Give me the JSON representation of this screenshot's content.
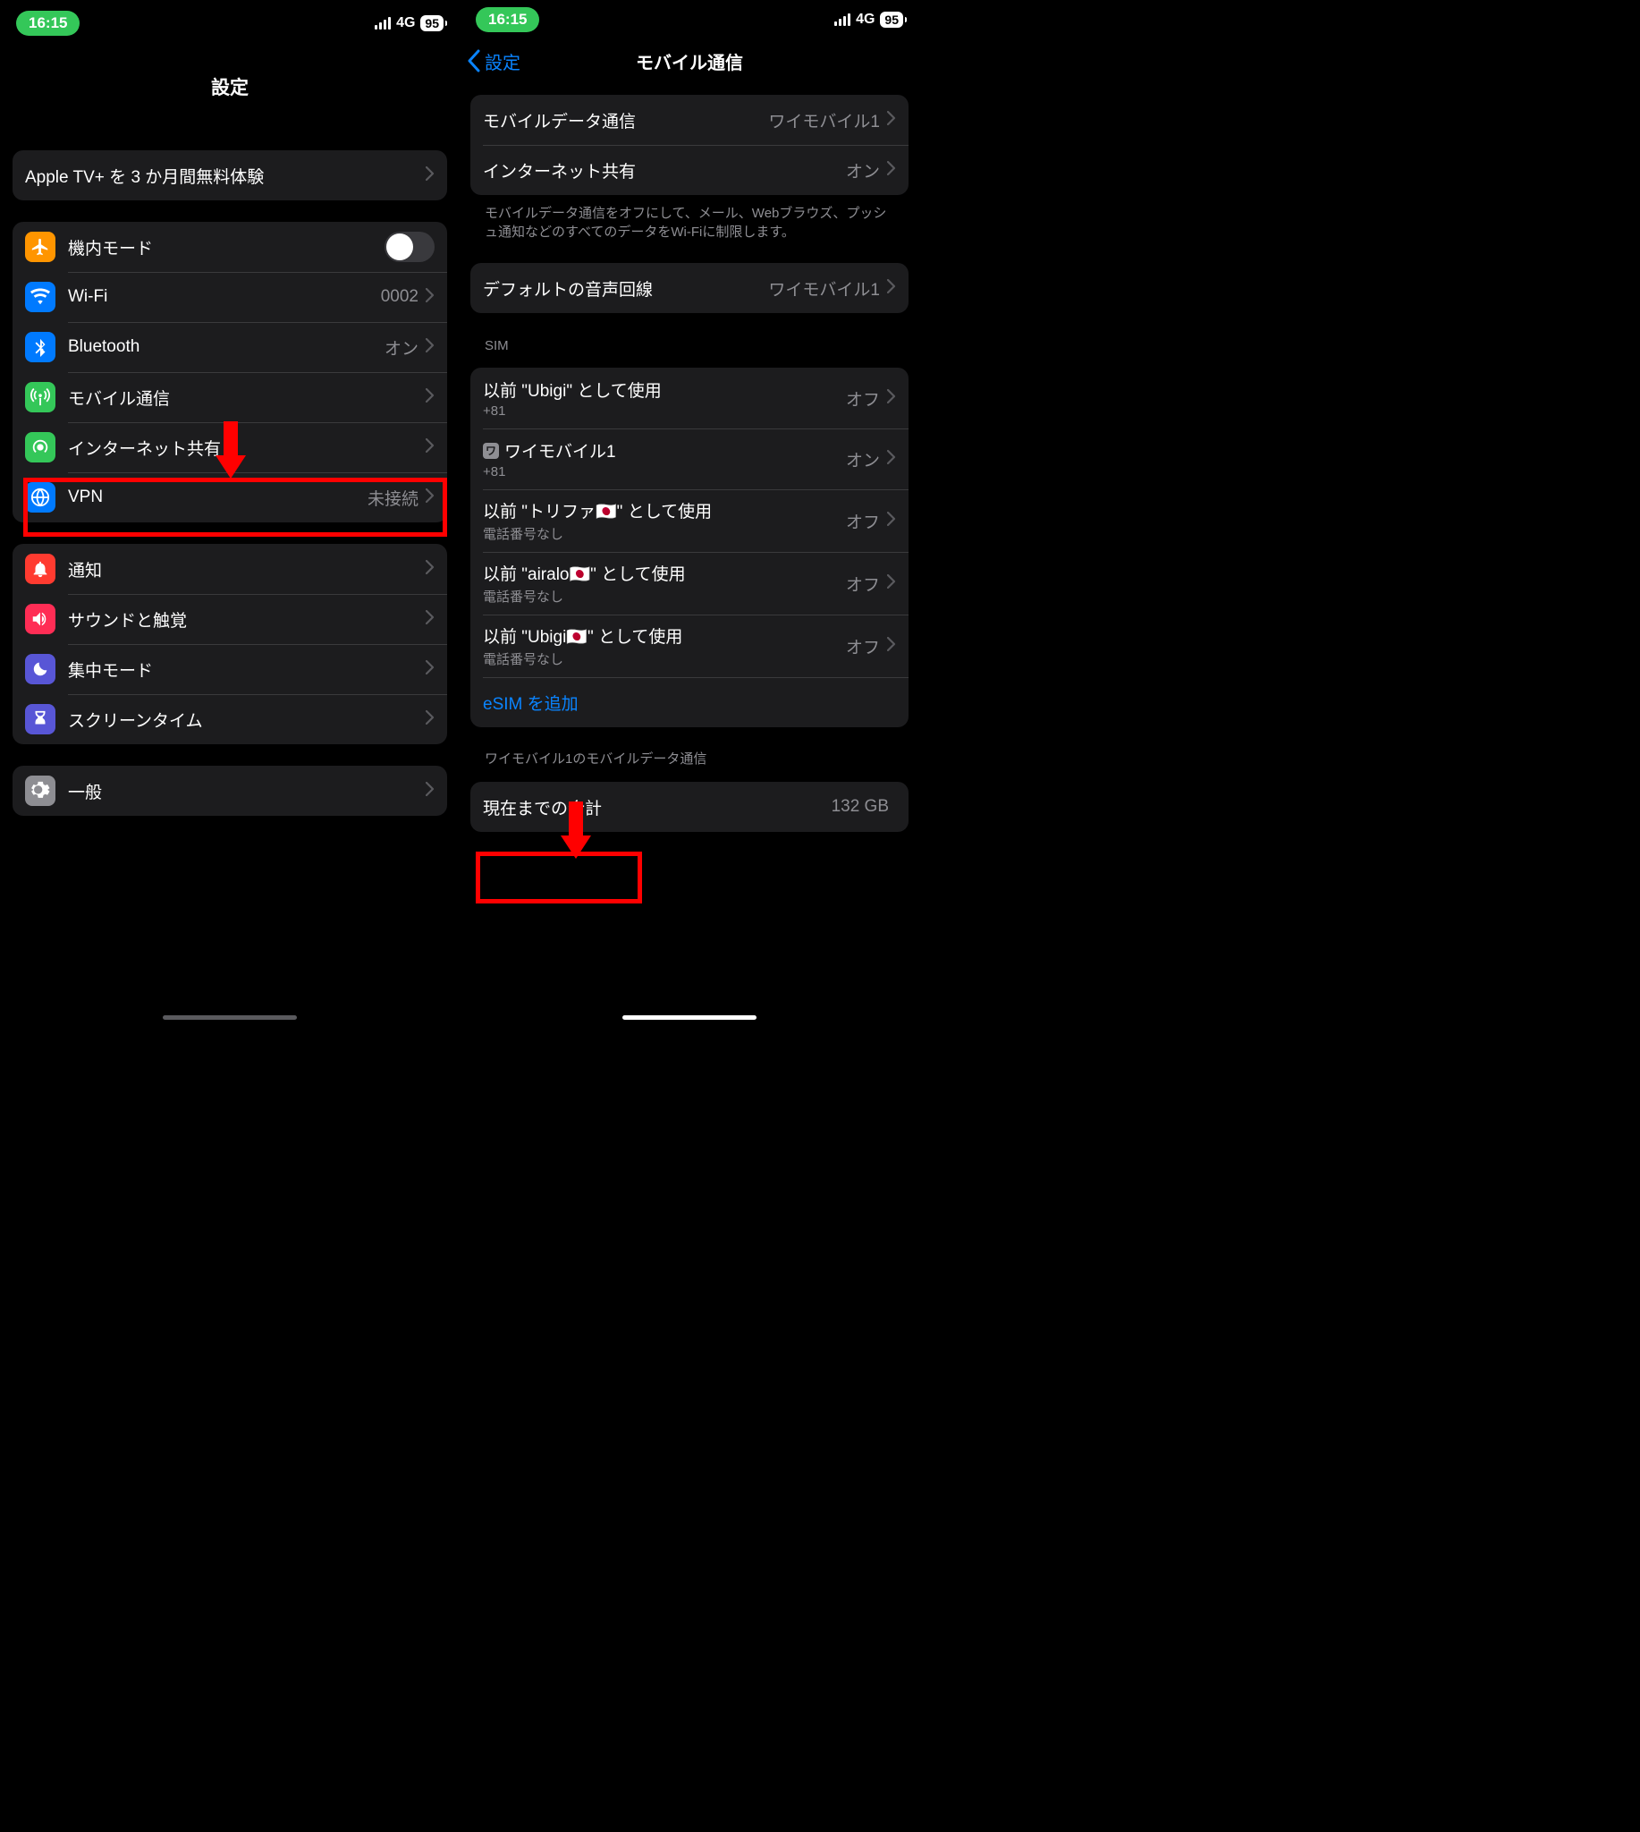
{
  "status": {
    "time": "16:15",
    "network": "4G",
    "battery": "95"
  },
  "left": {
    "title": "設定",
    "promo": {
      "label": "Apple TV+ を 3 か月間無料体験"
    },
    "network_group": [
      {
        "icon": "airplane",
        "label": "機内モード",
        "toggle": false,
        "bg": "bg-orange"
      },
      {
        "icon": "wifi",
        "label": "Wi-Fi",
        "value": "0002",
        "bg": "bg-blue"
      },
      {
        "icon": "bluetooth",
        "label": "Bluetooth",
        "value": "オン",
        "bg": "bg-blue"
      },
      {
        "icon": "antenna",
        "label": "モバイル通信",
        "bg": "bg-green",
        "highlight": true
      },
      {
        "icon": "hotspot",
        "label": "インターネット共有",
        "bg": "bg-green"
      },
      {
        "icon": "vpn",
        "label": "VPN",
        "value": "未接続",
        "bg": "bg-bluedeep"
      }
    ],
    "alerts_group": [
      {
        "icon": "notifications",
        "label": "通知",
        "bg": "bg-red"
      },
      {
        "icon": "sound",
        "label": "サウンドと触覚",
        "bg": "bg-pink"
      },
      {
        "icon": "moon",
        "label": "集中モード",
        "bg": "bg-indigo"
      },
      {
        "icon": "screentime",
        "label": "スクリーンタイム",
        "bg": "bg-indigo"
      }
    ],
    "general_group": [
      {
        "icon": "gear",
        "label": "一般",
        "bg": "bg-gray"
      }
    ]
  },
  "right": {
    "back": "設定",
    "title": "モバイル通信",
    "data_group": [
      {
        "label": "モバイルデータ通信",
        "value": "ワイモバイル1"
      },
      {
        "label": "インターネット共有",
        "value": "オン"
      }
    ],
    "data_footer": "モバイルデータ通信をオフにして、メール、Webブラウズ、プッシュ通知などのすべてのデータをWi-Fiに制限します。",
    "voice_group": [
      {
        "label": "デフォルトの音声回線",
        "value": "ワイモバイル1"
      }
    ],
    "sim_header": "SIM",
    "sim_group": [
      {
        "label": "以前 \"Ubigi\" として使用",
        "sub": "+81",
        "value": "オフ"
      },
      {
        "badge": "ワ",
        "label": "ワイモバイル1",
        "sub": "+81",
        "value": "オン"
      },
      {
        "label": "以前 \"トリファ🇯🇵\" として使用",
        "sub": "電話番号なし",
        "value": "オフ"
      },
      {
        "label": "以前 \"airalo🇯🇵\" として使用",
        "sub": "電話番号なし",
        "value": "オフ"
      },
      {
        "label": "以前 \"Ubigi🇯🇵\" として使用",
        "sub": "電話番号なし",
        "value": "オフ"
      }
    ],
    "add_esim": "eSIM を追加",
    "usage_header": "ワイモバイル1のモバイルデータ通信",
    "usage_group": [
      {
        "label": "現在までの合計",
        "value": "132 GB"
      }
    ]
  }
}
